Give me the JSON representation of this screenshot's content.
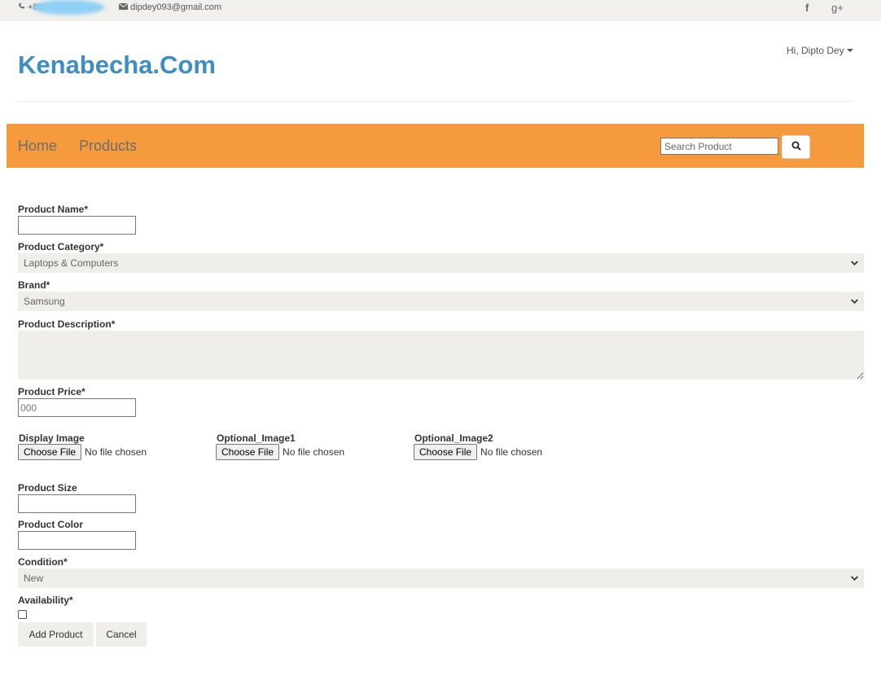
{
  "topbar": {
    "phone": "+88",
    "email": "dipdey093@gmail.com",
    "facebook": "f",
    "googleplus": "g+"
  },
  "brand": "Kenabecha.Com",
  "user": {
    "greeting": "Hi, Dipto Dey"
  },
  "nav": {
    "home": "Home",
    "products": "Products",
    "search_placeholder": "Search Product"
  },
  "form": {
    "product_name_label": "Product Name*",
    "category_label": "Product Category*",
    "category_value": "Laptops & Computers",
    "brand_label": "Brand*",
    "brand_value": "Samsung",
    "description_label": "Product Description*",
    "price_label": "Product Price*",
    "price_placeholder": "000",
    "images": [
      {
        "label": "Display Image",
        "button": "Choose File",
        "status": "No file chosen"
      },
      {
        "label": "Optional_Image1",
        "button": "Choose File",
        "status": "No file chosen"
      },
      {
        "label": "Optional_Image2",
        "button": "Choose File",
        "status": "No file chosen"
      }
    ],
    "size_label": "Product Size",
    "color_label": "Product Color",
    "condition_label": "Condition*",
    "condition_value": "New",
    "availability_label": "Availability*",
    "add_button": "Add Product",
    "cancel_button": "Cancel"
  },
  "colors": {
    "brand": "#3f8dc3",
    "navbar": "#f59b3e",
    "field_bg": "#efeee9"
  }
}
